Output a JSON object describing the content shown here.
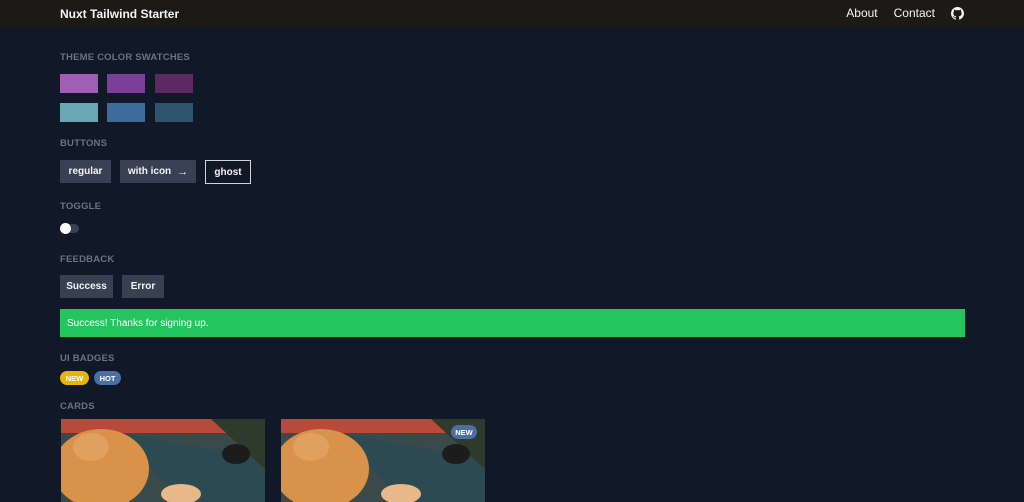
{
  "header": {
    "title": "Nuxt Tailwind Starter",
    "nav": {
      "about": "About",
      "contact": "Contact",
      "github_icon": "github-icon"
    }
  },
  "sections": {
    "swatches": "THEME COLOR SWATCHES",
    "buttons": "BUTTONS",
    "toggle": "TOGGLE",
    "feedback": "FEEDBACK",
    "badges": "UI BADGES",
    "cards": "CARDS"
  },
  "swatches": {
    "row1": [
      "#a05fb5",
      "#7a3f96",
      "#5b2a63"
    ],
    "row2": [
      "#6aa6b6",
      "#3d6c9c",
      "#2f546f"
    ]
  },
  "buttons": {
    "regular": "regular",
    "with_icon": "with icon",
    "with_icon_glyph": "→",
    "ghost": "ghost"
  },
  "toggle": {
    "on": false
  },
  "feedback": {
    "success": "Success",
    "error": "Error",
    "alert_text": "Success! Thanks for signing up.",
    "alert_color": "#22c55e"
  },
  "badges": [
    {
      "label": "NEW",
      "color": "#eab308"
    },
    {
      "label": "HOT",
      "color": "#4a6fa5"
    }
  ],
  "cards": [
    {
      "image": "cat-photo",
      "badge": ""
    },
    {
      "image": "cat-photo",
      "badge": "NEW"
    }
  ]
}
